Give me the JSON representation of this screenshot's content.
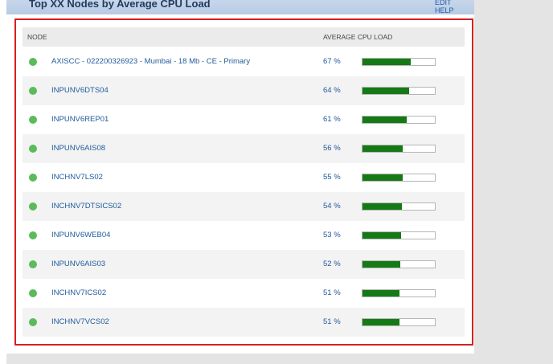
{
  "panel": {
    "title": "Top XX Nodes by Average CPU Load",
    "edit_label": "EDIT",
    "help_label": "HELP"
  },
  "table": {
    "headers": {
      "node": "NODE",
      "cpu": "AVERAGE CPU LOAD"
    },
    "rows": [
      {
        "name": "AXISCC - 022200326923 - Mumbai - 18 Mb - CE - Primary",
        "pct": "67 %",
        "value": 67,
        "status": "up"
      },
      {
        "name": "INPUNV6DTS04",
        "pct": "64 %",
        "value": 64,
        "status": "up"
      },
      {
        "name": "INPUNV6REP01",
        "pct": "61 %",
        "value": 61,
        "status": "up"
      },
      {
        "name": "INPUNV6AIS08",
        "pct": "56 %",
        "value": 56,
        "status": "up"
      },
      {
        "name": "INCHNV7LS02",
        "pct": "55 %",
        "value": 55,
        "status": "up"
      },
      {
        "name": "INCHNV7DTSICS02",
        "pct": "54 %",
        "value": 54,
        "status": "up"
      },
      {
        "name": "INPUNV6WEB04",
        "pct": "53 %",
        "value": 53,
        "status": "up"
      },
      {
        "name": "INPUNV6AIS03",
        "pct": "52 %",
        "value": 52,
        "status": "up"
      },
      {
        "name": "INCHNV7ICS02",
        "pct": "51 %",
        "value": 51,
        "status": "up"
      },
      {
        "name": "INCHNV7VCS02",
        "pct": "51 %",
        "value": 51,
        "status": "up"
      }
    ]
  },
  "colors": {
    "status_up": "#5bbb5b",
    "bar_fill": "#157a15",
    "highlight_border": "#d81f1f",
    "link": "#1f5a9a"
  }
}
